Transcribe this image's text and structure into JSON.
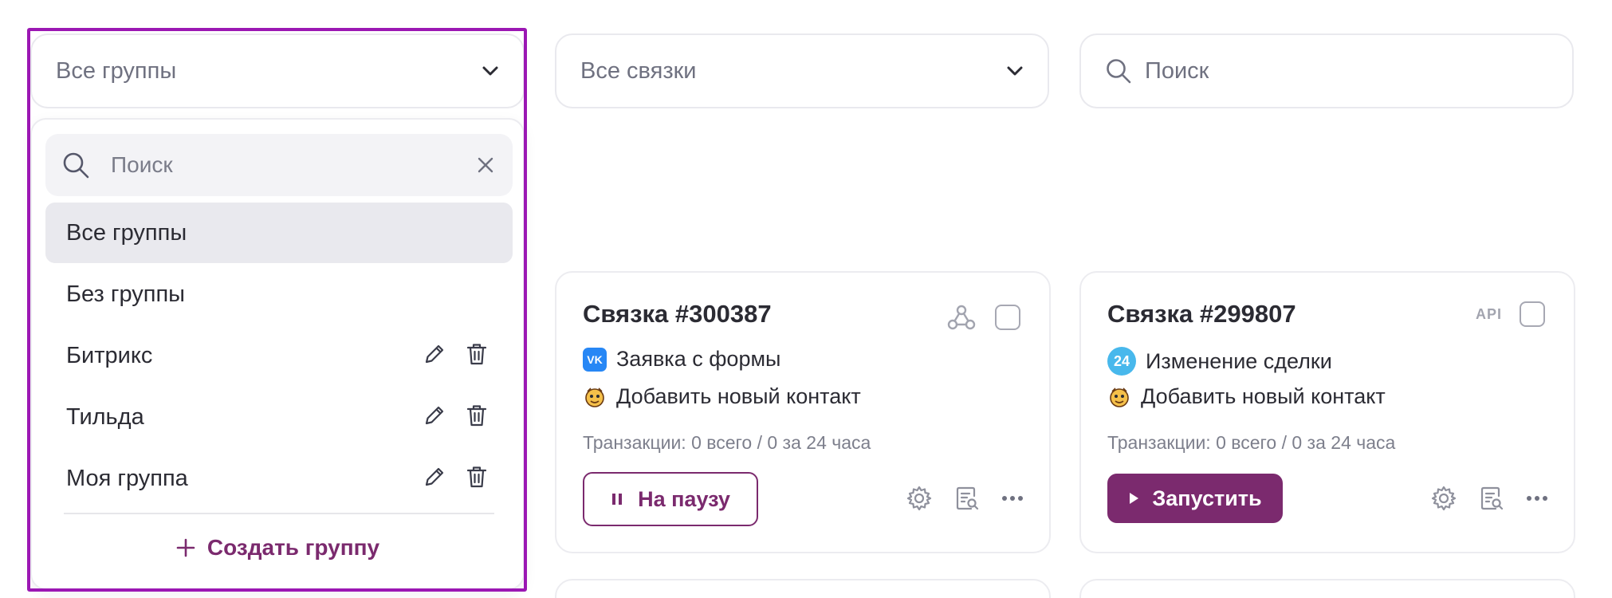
{
  "filters": {
    "groups_select": "Все группы",
    "links_select": "Все связки",
    "search_placeholder": "Поиск"
  },
  "dropdown": {
    "search_placeholder": "Поиск",
    "items": [
      {
        "label": "Все группы",
        "active": true,
        "editable": false
      },
      {
        "label": "Без группы",
        "active": false,
        "editable": false
      },
      {
        "label": "Битрикс",
        "active": false,
        "editable": true
      },
      {
        "label": "Тильда",
        "active": false,
        "editable": true
      },
      {
        "label": "Моя группа",
        "active": false,
        "editable": true
      }
    ],
    "create_label": "Создать группу"
  },
  "cards": [
    {
      "title": "Связка #300387",
      "source_icon": "webhook-icon",
      "trigger": "Заявка с формы",
      "trigger_icon": "vk-icon",
      "trigger_icon_text": "VK",
      "action": "Добавить новый контакт",
      "action_icon": "crm-mascot-icon",
      "transactions": "Транзакции: 0 всего / 0 за 24 часа",
      "button_label": "На паузу",
      "button_state": "running"
    },
    {
      "title": "Связка #299807",
      "source_label": "API",
      "trigger": "Изменение сделки",
      "trigger_icon": "bitrix24-icon",
      "trigger_icon_text": "24",
      "action": "Добавить новый контакт",
      "action_icon": "crm-mascot-icon",
      "transactions": "Транзакции: 0 всего / 0 за 24 часа",
      "button_label": "Запустить",
      "button_state": "paused"
    }
  ],
  "colors": {
    "accent": "#7b2a6e",
    "highlight_outline": "#9b17b3",
    "border": "#ececf0",
    "muted_text": "#7d7f8c",
    "vk": "#2787f5",
    "bitrix24": "#48b8ec"
  }
}
